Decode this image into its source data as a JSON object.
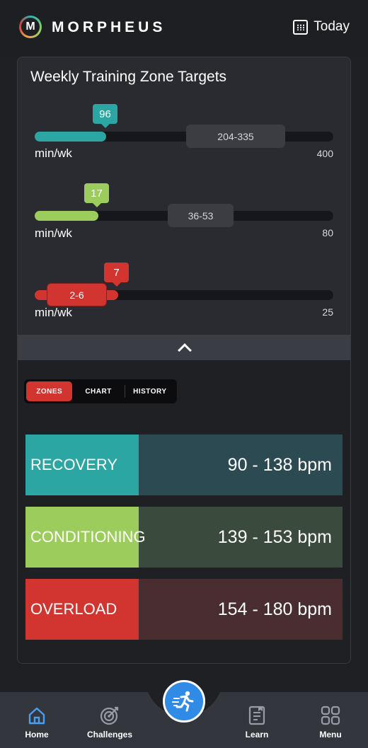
{
  "header": {
    "brand": "MORPHEUS",
    "logo_letter": "M",
    "date_label": "Today",
    "calendar_icon": "calendar-icon"
  },
  "card": {
    "title": "Weekly Training Zone Targets",
    "sliders": [
      {
        "name": "recovery",
        "value": "96",
        "range": "204-335",
        "unit": "min/wk",
        "max": "400",
        "color": "#2ba6a3",
        "value_fraction": 0.24
      },
      {
        "name": "conditioning",
        "value": "17",
        "range": "36-53",
        "unit": "min/wk",
        "max": "80",
        "color": "#9ccd5c",
        "value_fraction": 0.21
      },
      {
        "name": "overload",
        "value": "7",
        "range": "2-6",
        "unit": "min/wk",
        "max": "25",
        "color": "#d2342f",
        "value_fraction": 0.28
      }
    ],
    "collapse_icon": "chevron-up-icon"
  },
  "tabs": [
    {
      "label": "ZONES",
      "active": true
    },
    {
      "label": "CHART",
      "active": false
    },
    {
      "label": "HISTORY",
      "active": false
    }
  ],
  "zones": [
    {
      "name": "RECOVERY",
      "bpm": "90 - 138 bpm",
      "color": "#2ba6a3",
      "bg": "#2c4a52"
    },
    {
      "name": "CONDITIONING",
      "bpm": "139 - 153 bpm",
      "color": "#9ccd5c",
      "bg": "#3a4a3d"
    },
    {
      "name": "OVERLOAD",
      "bpm": "154 - 180 bpm",
      "color": "#d2342f",
      "bg": "#4a2d30"
    }
  ],
  "nav": {
    "items": [
      {
        "label": "Home",
        "icon": "home-icon",
        "active": true
      },
      {
        "label": "Challenges",
        "icon": "target-icon"
      },
      {
        "label": "Learn",
        "icon": "book-icon"
      },
      {
        "label": "Menu",
        "icon": "grid-icon"
      }
    ],
    "fab_icon": "running-icon"
  }
}
